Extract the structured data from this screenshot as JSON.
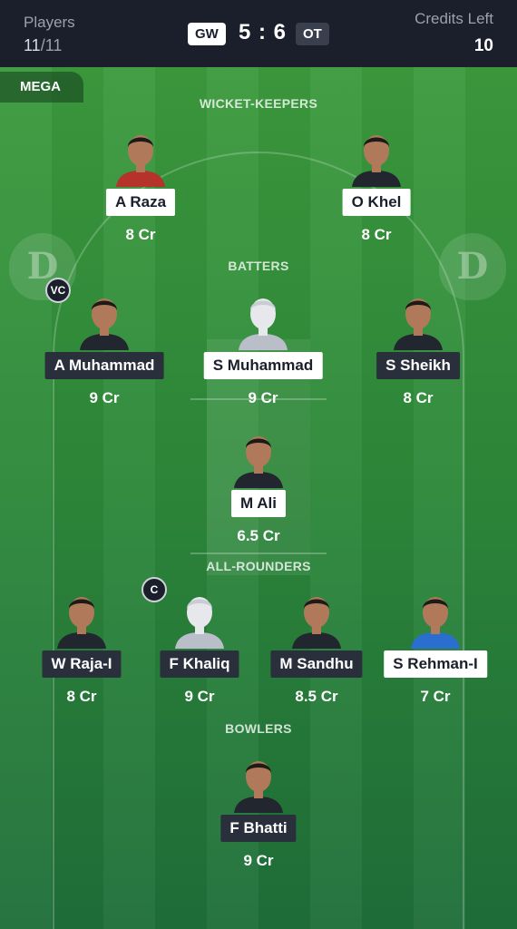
{
  "header": {
    "players_label": "Players",
    "players_selected": "11",
    "players_total": "/11",
    "team_left": "GW",
    "score": "5 : 6",
    "team_right": "OT",
    "credits_label": "Credits Left",
    "credits_value": "10"
  },
  "contest_tag": "MEGA",
  "sections": {
    "wicket_keepers": "WICKET-KEEPERS",
    "batters": "BATTERS",
    "all_rounders": "ALL-ROUNDERS",
    "bowlers": "BOWLERS"
  },
  "watermark_letter": "D",
  "captain_badges": {
    "vc": "VC",
    "c": "C"
  },
  "players": {
    "wk1": {
      "name": "A Raza",
      "credits": "8 Cr",
      "jersey": "#b5332b"
    },
    "wk2": {
      "name": "O Khel",
      "credits": "8 Cr",
      "jersey": "#22262f"
    },
    "bat1": {
      "name": "A Muhammad",
      "credits": "9 Cr",
      "jersey": "#22262f"
    },
    "bat2": {
      "name": "S Muhammad",
      "credits": "9 Cr",
      "jersey": "#b9bec8"
    },
    "bat3": {
      "name": "S Sheikh",
      "credits": "8 Cr",
      "jersey": "#22262f"
    },
    "bat4": {
      "name": "M Ali",
      "credits": "6.5 Cr",
      "jersey": "#22262f"
    },
    "ar1": {
      "name": "W Raja-I",
      "credits": "8 Cr",
      "jersey": "#22262f"
    },
    "ar2": {
      "name": "F Khaliq",
      "credits": "9 Cr",
      "jersey": "#b9bec8"
    },
    "ar3": {
      "name": "M Sandhu",
      "credits": "8.5 Cr",
      "jersey": "#22262f"
    },
    "ar4": {
      "name": "S Rehman-I",
      "credits": "7 Cr",
      "jersey": "#2a6fcf"
    },
    "bowl1": {
      "name": "F Bhatti",
      "credits": "9 Cr",
      "jersey": "#22262f"
    }
  }
}
